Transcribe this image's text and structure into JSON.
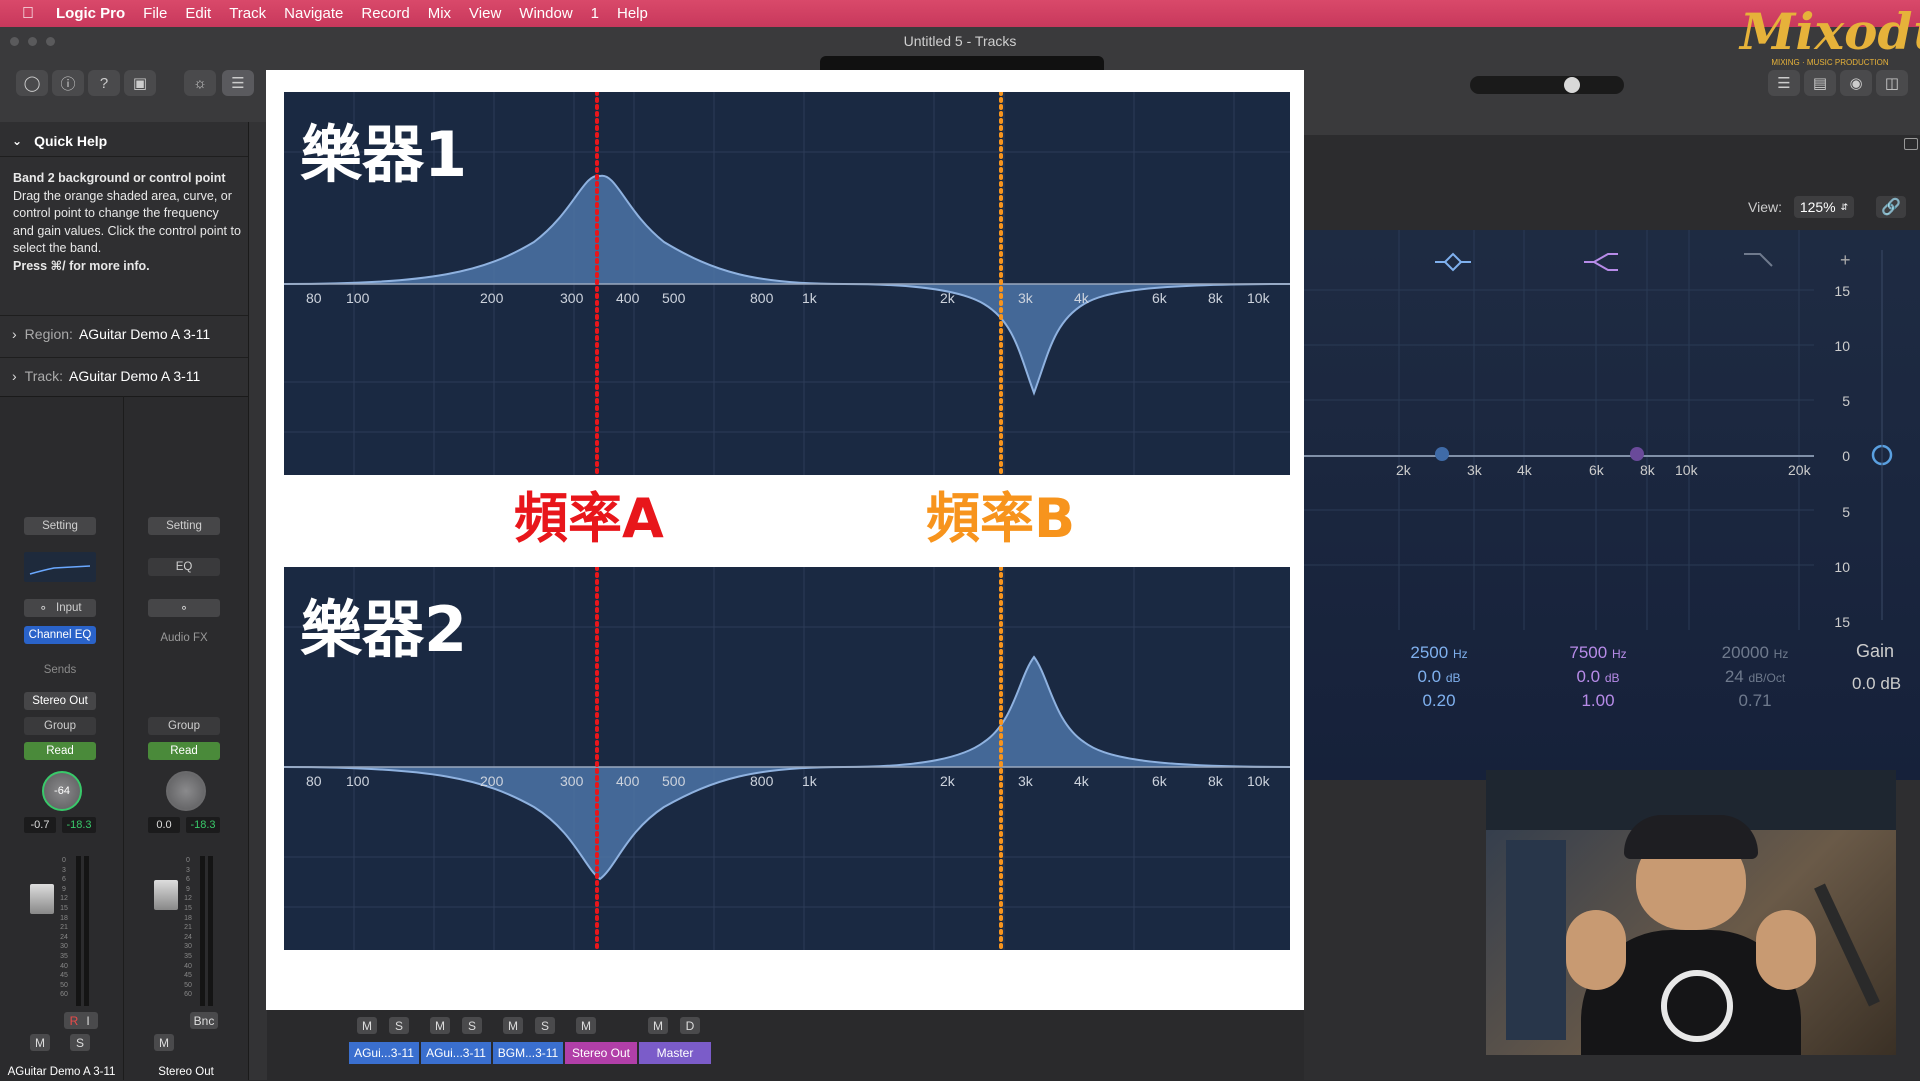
{
  "menubar": {
    "app": "Logic Pro",
    "items": [
      "File",
      "Edit",
      "Track",
      "Navigate",
      "Record",
      "Mix",
      "View",
      "Window",
      "1",
      "Help"
    ]
  },
  "window": {
    "title": "Untitled 5 - Tracks"
  },
  "watermark": {
    "text": "Mixodus",
    "subtitle": "MIXING · MUSIC PRODUCTION"
  },
  "quick_help": {
    "header": "Quick Help",
    "heading": "Band 2 background or control point",
    "body": "Drag the orange shaded area, curve, or control point to change the frequency and gain values. Click the control point to select the band.",
    "more": "Press ⌘/ for more info.",
    "region_key": "Region:",
    "region_val": "AGuitar Demo A 3-11",
    "track_key": "Track:",
    "track_val": "AGuitar Demo A 3-11"
  },
  "strip1": {
    "setting": "Setting",
    "input": "Input",
    "plugin": "Channel EQ",
    "sends": "Sends",
    "output": "Stereo Out",
    "group": "Group",
    "automation": "Read",
    "pan": "-64",
    "vol": "-0.7",
    "peak": "-18.3",
    "name": "AGuitar Demo A 3-11",
    "mute": "M",
    "solo": "S",
    "rec": "R",
    "input_mon": "I"
  },
  "strip2": {
    "setting": "Setting",
    "eq": "EQ",
    "audiofx": "Audio FX",
    "group": "Group",
    "automation": "Read",
    "vol": "0.0",
    "peak": "-18.3",
    "name": "Stereo Out",
    "bnc": "Bnc",
    "mute": "M"
  },
  "meter_scale": [
    "0",
    "3",
    "6",
    "9",
    "12",
    "15",
    "18",
    "21",
    "24",
    "30",
    "35",
    "40",
    "45",
    "50",
    "60"
  ],
  "mixer_bottom": {
    "buttons": [
      "M",
      "S",
      "M",
      "S",
      "M",
      "S",
      "M",
      "M",
      "D"
    ],
    "channels": [
      {
        "name": "AGui...3-11",
        "color": "#3a6fcf"
      },
      {
        "name": "AGui...3-11",
        "color": "#3a6fcf"
      },
      {
        "name": "BGM...3-11",
        "color": "#3a6fcf"
      },
      {
        "name": "Stereo Out",
        "color": "#b13fa8"
      },
      {
        "name": "Master",
        "color": "#7b5cc9"
      }
    ]
  },
  "eq_panel": {
    "view_label": "View:",
    "view_value": "125%",
    "freq_ticks": [
      "2k",
      "3k",
      "4k",
      "6k",
      "8k",
      "10k",
      "20k"
    ],
    "db_ticks": [
      "15",
      "10",
      "5",
      "0",
      "5",
      "10",
      "15"
    ],
    "gain_label": "Gain",
    "gain_value": "0.0 dB",
    "bands": [
      {
        "freq": "2500",
        "freq_unit": "Hz",
        "gain": "0.0",
        "gain_unit": "dB",
        "q": "0.20",
        "color": "#7fb0ee"
      },
      {
        "freq": "7500",
        "freq_unit": "Hz",
        "gain": "0.0",
        "gain_unit": "dB",
        "q": "1.00",
        "color": "#b78be8"
      },
      {
        "freq": "20000",
        "freq_unit": "Hz",
        "gain": "24",
        "gain_unit": "dB/Oct",
        "q": "0.71",
        "color": "#6f7a8d"
      }
    ]
  },
  "slide": {
    "panel1_title": "樂器1",
    "panel2_title": "樂器2",
    "label_a": "頻率A",
    "label_b": "頻率B",
    "color_a": "#e8161b",
    "color_b": "#f7941d",
    "freq_ticks": [
      "80",
      "100",
      "200",
      "300",
      "400",
      "500",
      "800",
      "1k",
      "2k",
      "3k",
      "4k",
      "6k",
      "8k",
      "10k"
    ]
  }
}
